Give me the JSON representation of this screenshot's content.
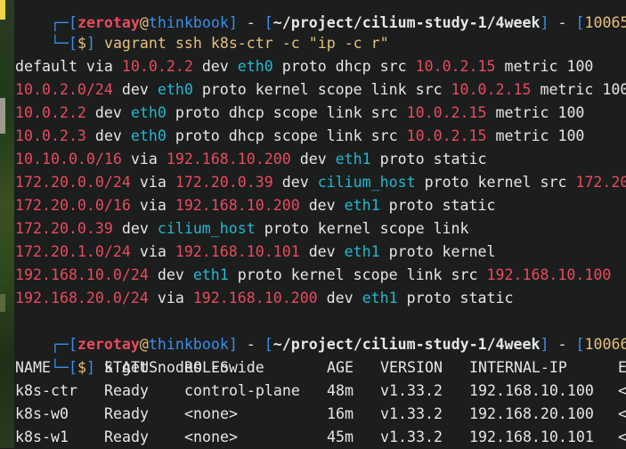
{
  "prompt_top": {
    "user": "zerotay",
    "host": "thinkbook",
    "path": "~/project/cilium-study-1/4week",
    "pid": "10065",
    "symbol": "$",
    "command": "vagrant ssh k8s-ctr -c \"ip -c r\""
  },
  "routes": [
    [
      [
        "default via ",
        "w"
      ],
      [
        "10.0.2.2",
        "r"
      ],
      [
        " dev ",
        "w"
      ],
      [
        "eth0",
        "c"
      ],
      [
        " proto dhcp src ",
        "w"
      ],
      [
        "10.0.2.15",
        "r"
      ],
      [
        " metric 100",
        "w"
      ]
    ],
    [
      [
        "10.0.2.0/24",
        "r"
      ],
      [
        " dev ",
        "w"
      ],
      [
        "eth0",
        "c"
      ],
      [
        " proto kernel scope link src ",
        "w"
      ],
      [
        "10.0.2.15",
        "r"
      ],
      [
        " metric 100",
        "w"
      ]
    ],
    [
      [
        "10.0.2.2",
        "r"
      ],
      [
        " dev ",
        "w"
      ],
      [
        "eth0",
        "c"
      ],
      [
        " proto dhcp scope link src ",
        "w"
      ],
      [
        "10.0.2.15",
        "r"
      ],
      [
        " metric 100",
        "w"
      ]
    ],
    [
      [
        "10.0.2.3",
        "r"
      ],
      [
        " dev ",
        "w"
      ],
      [
        "eth0",
        "c"
      ],
      [
        " proto dhcp scope link src ",
        "w"
      ],
      [
        "10.0.2.15",
        "r"
      ],
      [
        " metric 100",
        "w"
      ]
    ],
    [
      [
        "10.10.0.0/16",
        "r"
      ],
      [
        " via ",
        "w"
      ],
      [
        "192.168.10.200",
        "r"
      ],
      [
        " dev ",
        "w"
      ],
      [
        "eth1",
        "c"
      ],
      [
        " proto static",
        "w"
      ]
    ],
    [
      [
        "172.20.0.0/24",
        "r"
      ],
      [
        " via ",
        "w"
      ],
      [
        "172.20.0.39",
        "r"
      ],
      [
        " dev ",
        "w"
      ],
      [
        "cilium_host",
        "c"
      ],
      [
        " proto kernel src ",
        "w"
      ],
      [
        "172.20",
        "r"
      ]
    ],
    [
      [
        "172.20.0.0/16",
        "r"
      ],
      [
        " via ",
        "w"
      ],
      [
        "192.168.10.200",
        "r"
      ],
      [
        " dev ",
        "w"
      ],
      [
        "eth1",
        "c"
      ],
      [
        " proto static",
        "w"
      ]
    ],
    [
      [
        "172.20.0.39",
        "r"
      ],
      [
        " dev ",
        "w"
      ],
      [
        "cilium_host",
        "c"
      ],
      [
        " proto kernel scope link",
        "w"
      ]
    ],
    [
      [
        "172.20.1.0/24",
        "r"
      ],
      [
        " via ",
        "w"
      ],
      [
        "192.168.10.101",
        "r"
      ],
      [
        " dev ",
        "w"
      ],
      [
        "eth1",
        "c"
      ],
      [
        " proto kernel",
        "w"
      ]
    ],
    [
      [
        "192.168.10.0/24",
        "r"
      ],
      [
        " dev ",
        "w"
      ],
      [
        "eth1",
        "c"
      ],
      [
        " proto kernel scope link src ",
        "w"
      ],
      [
        "192.168.10.100",
        "r"
      ]
    ],
    [
      [
        "192.168.20.0/24",
        "r"
      ],
      [
        " via ",
        "w"
      ],
      [
        "192.168.10.200",
        "r"
      ],
      [
        " dev ",
        "w"
      ],
      [
        "eth1",
        "c"
      ],
      [
        " proto static",
        "w"
      ]
    ]
  ],
  "prompt_bottom": {
    "user": "zerotay",
    "host": "thinkbook",
    "path": "~/project/cilium-study-1/4week",
    "pid": "10066",
    "symbol": "$",
    "command": "k get nodes -owide"
  },
  "nodes_table": {
    "headers": [
      "NAME",
      "STATUS",
      "ROLES",
      "AGE",
      "VERSION",
      "INTERNAL-IP",
      "E"
    ],
    "rows": [
      [
        "k8s-ctr",
        "Ready",
        "control-plane",
        "48m",
        "v1.33.2",
        "192.168.10.100",
        "<"
      ],
      [
        "k8s-w0",
        "Ready",
        "<none>",
        "16m",
        "v1.33.2",
        "192.168.20.100",
        "<"
      ],
      [
        "k8s-w1",
        "Ready",
        "<none>",
        "45m",
        "v1.33.2",
        "192.168.10.101",
        "<"
      ]
    ]
  }
}
